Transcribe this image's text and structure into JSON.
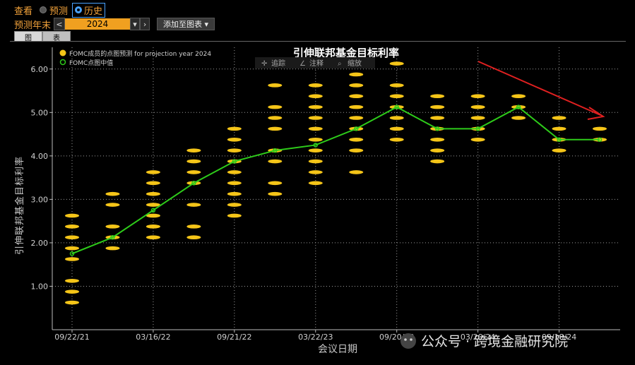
{
  "toolbar": {
    "view_label": "查看",
    "forecast_label": "预测",
    "history_label": "历史",
    "year_end_label": "预测年末",
    "year_value": "2024",
    "prev_label": "<",
    "dropdown_label": "▾",
    "next_label": "›",
    "add_chart_label": "添加至图表 ▾"
  },
  "tabs": [
    "图",
    "表"
  ],
  "chart_tools": [
    "追踪",
    "注释",
    "缩放"
  ],
  "watermark": "公众号 · 跨境金融研究院",
  "colors": {
    "dots": "#f5c518",
    "median_line": "#2ecc1a",
    "arrow": "#e02020",
    "grid": "#9a9a9a",
    "axis_text": "#d0d0d0"
  },
  "chart_data": {
    "type": "scatter",
    "title": "引伸联邦基金目标利率",
    "xlabel": "会议日期",
    "ylabel": "引伸联邦基金目标利率",
    "ylim": [
      0,
      6.5
    ],
    "yticks": [
      "1.00",
      "2.00",
      "3.00",
      "4.00",
      "5.00",
      "6.00"
    ],
    "xticks": [
      "09/22/21",
      "03/16/22",
      "09/21/22",
      "03/22/23",
      "09/20/23",
      "03/20/24",
      "09/18/24"
    ],
    "legend": [
      {
        "name": "FOMC成员的点图预测 for projection year 2024",
        "marker": "dot"
      },
      {
        "name": "FOMC点图中值",
        "marker": "ring"
      }
    ],
    "meetings": [
      {
        "date": "09/22/21",
        "dots": [
          0.625,
          0.875,
          1.125,
          1.625,
          1.875,
          2.125,
          2.375,
          2.625
        ],
        "median": 1.75
      },
      {
        "date": "12/15/21",
        "dots": [
          1.875,
          2.125,
          2.375,
          2.875,
          3.125
        ],
        "median": 2.125
      },
      {
        "date": "03/16/22",
        "dots": [
          2.125,
          2.375,
          2.625,
          2.875,
          3.125,
          3.375,
          3.625
        ],
        "median": 2.75
      },
      {
        "date": "06/15/22",
        "dots": [
          2.125,
          2.375,
          2.875,
          3.375,
          3.625,
          3.875,
          4.125
        ],
        "median": 3.375
      },
      {
        "date": "09/21/22",
        "dots": [
          2.625,
          2.875,
          3.125,
          3.375,
          3.625,
          3.875,
          4.125,
          4.375,
          4.625
        ],
        "median": 3.875
      },
      {
        "date": "12/14/22",
        "dots": [
          3.125,
          3.375,
          3.875,
          4.125,
          4.625,
          4.875,
          5.125,
          5.625
        ],
        "median": 4.125
      },
      {
        "date": "03/22/23",
        "dots": [
          3.375,
          3.625,
          3.875,
          4.125,
          4.375,
          4.625,
          4.875,
          5.125,
          5.375,
          5.625
        ],
        "median": 4.25
      },
      {
        "date": "06/14/23",
        "dots": [
          3.625,
          4.125,
          4.375,
          4.625,
          4.875,
          5.125,
          5.375,
          5.625,
          5.875
        ],
        "median": 4.625
      },
      {
        "date": "09/20/23",
        "dots": [
          4.375,
          4.625,
          4.875,
          5.125,
          5.375,
          5.625,
          6.125
        ],
        "median": 5.125
      },
      {
        "date": "12/13/23",
        "dots": [
          3.875,
          4.125,
          4.375,
          4.625,
          4.875,
          5.125,
          5.375
        ],
        "median": 4.625
      },
      {
        "date": "03/20/24",
        "dots": [
          4.375,
          4.625,
          4.875,
          5.125,
          5.375
        ],
        "median": 4.625
      },
      {
        "date": "06/12/24",
        "dots": [
          4.875,
          5.125,
          5.375
        ],
        "median": 5.125
      },
      {
        "date": "09/18/24",
        "dots": [
          4.125,
          4.375,
          4.625,
          4.875
        ],
        "median": 4.375
      },
      {
        "date": "12/18/24",
        "dots": [
          4.375,
          4.625
        ],
        "median": 4.375
      }
    ]
  }
}
